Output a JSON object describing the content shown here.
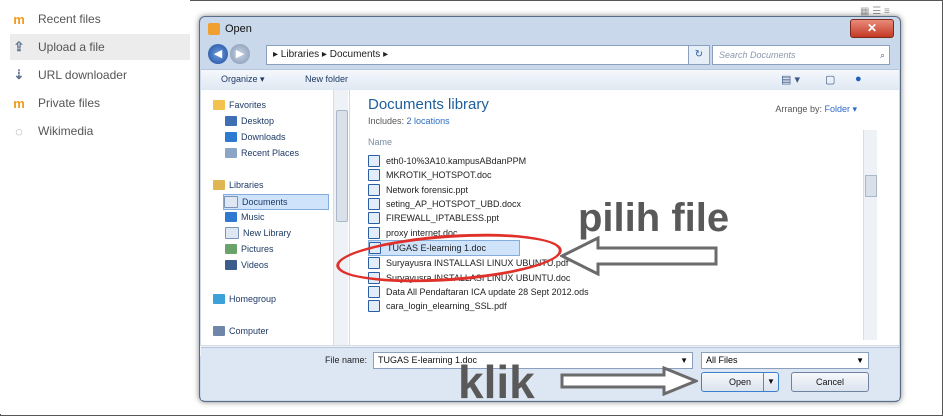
{
  "left_panel": {
    "items": [
      {
        "label": "Recent files",
        "icon": "moodle-icon"
      },
      {
        "label": "Upload a file",
        "icon": "upload-icon"
      },
      {
        "label": "URL downloader",
        "icon": "url-icon"
      },
      {
        "label": "Private files",
        "icon": "moodle-icon"
      },
      {
        "label": "Wikimedia",
        "icon": "wikimedia-icon"
      }
    ]
  },
  "dialog": {
    "title": "Open",
    "breadcrumb": "▸ Libraries ▸ Documents ▸",
    "search_placeholder": "Search Documents",
    "toolbar": {
      "organize": "Organize ▾",
      "new_folder": "New folder"
    },
    "nav": {
      "items": [
        {
          "label": "Favorites",
          "color": "#f2c14e"
        },
        {
          "label": "Desktop",
          "color": "#3f6fb5"
        },
        {
          "label": "Downloads",
          "color": "#2d7bd1"
        },
        {
          "label": "Recent Places",
          "color": "#8aa5c6"
        },
        {
          "label": "Libraries",
          "color": "#e0b650"
        },
        {
          "label": "Documents",
          "color": "#dfe7f2"
        },
        {
          "label": "Music",
          "color": "#2f7ad0"
        },
        {
          "label": "New Library",
          "color": "#dfe7f2"
        },
        {
          "label": "Pictures",
          "color": "#6aa36a"
        },
        {
          "label": "Videos",
          "color": "#3c5c8c"
        },
        {
          "label": "Homegroup",
          "color": "#3aa2d9"
        },
        {
          "label": "Computer",
          "color": "#6f86a8"
        }
      ]
    },
    "library_title": "Documents library",
    "includes_prefix": "Includes:",
    "includes_link": "2 locations",
    "arrange_label": "Arrange by:",
    "arrange_value": "Folder ▾",
    "column_name": "Name",
    "files": [
      "eth0-10%3A10.kampusABdanPPM",
      "MKROTIK_HOTSPOT.doc",
      "Network forensic.ppt",
      "seting_AP_HOTSPOT_UBD.docx",
      "FIREWALL_IPTABLESS.ppt",
      "proxy internet.doc",
      "TUGAS E-learning 1.doc",
      "Suryayusra INSTALLASI LINUX UBUNTU.pdf",
      "Suryayusra INSTALLASI LINUX UBUNTU.doc",
      "Data All Pendaftaran ICA update 28 Sept 2012.ods",
      "cara_login_elearning_SSL.pdf"
    ],
    "selected_index": 6,
    "file_name_label": "File name:",
    "file_name_value": "TUGAS E-learning 1.doc",
    "file_type": "All Files",
    "open_button": "Open",
    "cancel_button": "Cancel"
  },
  "annotations": {
    "pilih": "pilih file",
    "klik": "klik"
  }
}
